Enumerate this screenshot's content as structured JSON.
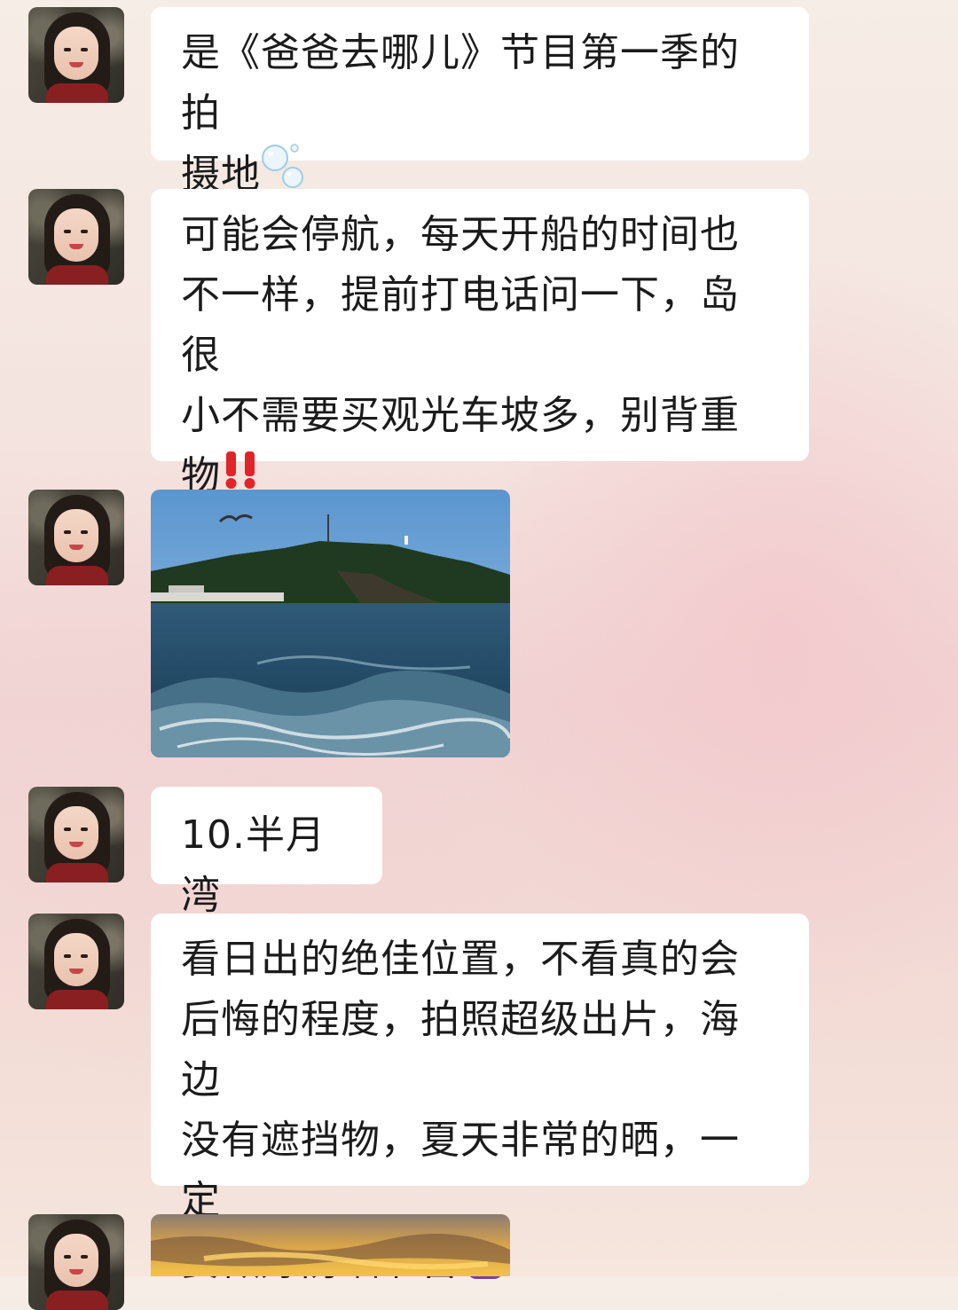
{
  "messages": [
    {
      "type": "text",
      "text": "是《爸爸去哪儿》节目第一季的拍\n摄地",
      "trailing_emoji": "bubbles-icon"
    },
    {
      "type": "text",
      "text": "可能会停航，每天开船的时间也\n不一样，提前打电话问一下，岛很\n小不需要买观光车坡多，别背重\n物",
      "trailing_emoji": "double-exclamation-icon"
    },
    {
      "type": "image",
      "description_icon": "island-sea-photo"
    },
    {
      "type": "text",
      "text": "10.半月湾"
    },
    {
      "type": "text",
      "text": "看日出的绝佳位置，不看真的会\n后悔的程度，拍照超级出片，海边\n没有遮挡物，夏天非常的晒，一定\n要做好防晒准备",
      "trailing_emoji": "person-raising-hand-icon"
    },
    {
      "type": "image",
      "description_icon": "sunrise-photo"
    }
  ],
  "colors": {
    "bubble": "#ffffff",
    "text": "#1b1b1b",
    "exclamation": "#e0242a"
  }
}
